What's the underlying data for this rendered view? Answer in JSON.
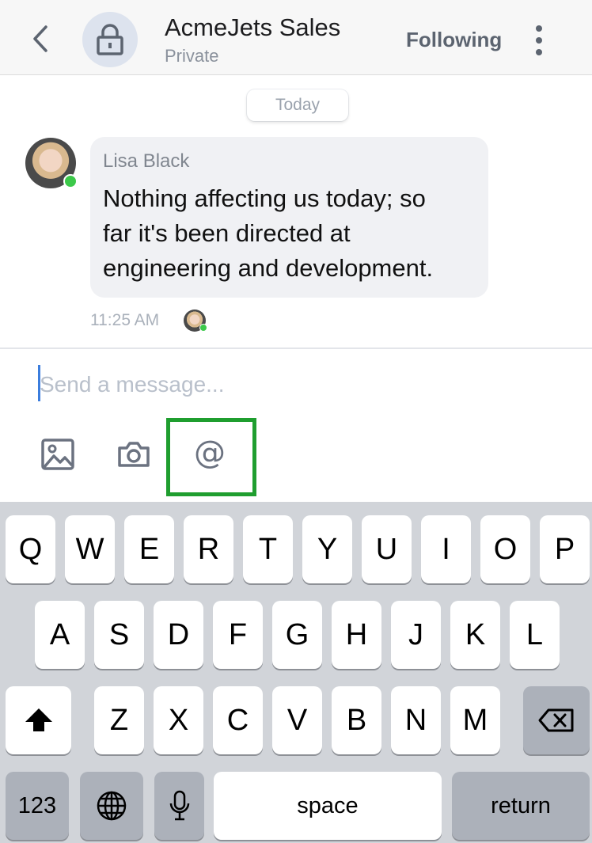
{
  "header": {
    "title": "AcmeJets Sales",
    "subtitle": "Private",
    "following_label": "Following"
  },
  "date_chip": "Today",
  "message": {
    "sender": "Lisa Black",
    "lines": [
      "Nothing affecting us today; so",
      "far it's been directed at",
      "engineering and development."
    ],
    "time": "11:25 AM"
  },
  "composer": {
    "placeholder": "Send a message...",
    "mention_symbol": "@"
  },
  "keyboard": {
    "row1": [
      "Q",
      "W",
      "E",
      "R",
      "T",
      "Y",
      "U",
      "I",
      "O",
      "P"
    ],
    "row2": [
      "A",
      "S",
      "D",
      "F",
      "G",
      "H",
      "J",
      "K",
      "L"
    ],
    "row3": [
      "Z",
      "X",
      "C",
      "V",
      "B",
      "N",
      "M"
    ],
    "numbers_label": "123",
    "space_label": "space",
    "return_label": "return"
  },
  "colors": {
    "online": "#3cc94a",
    "highlight": "#1f9e2f",
    "cursor": "#3b7ddd"
  }
}
